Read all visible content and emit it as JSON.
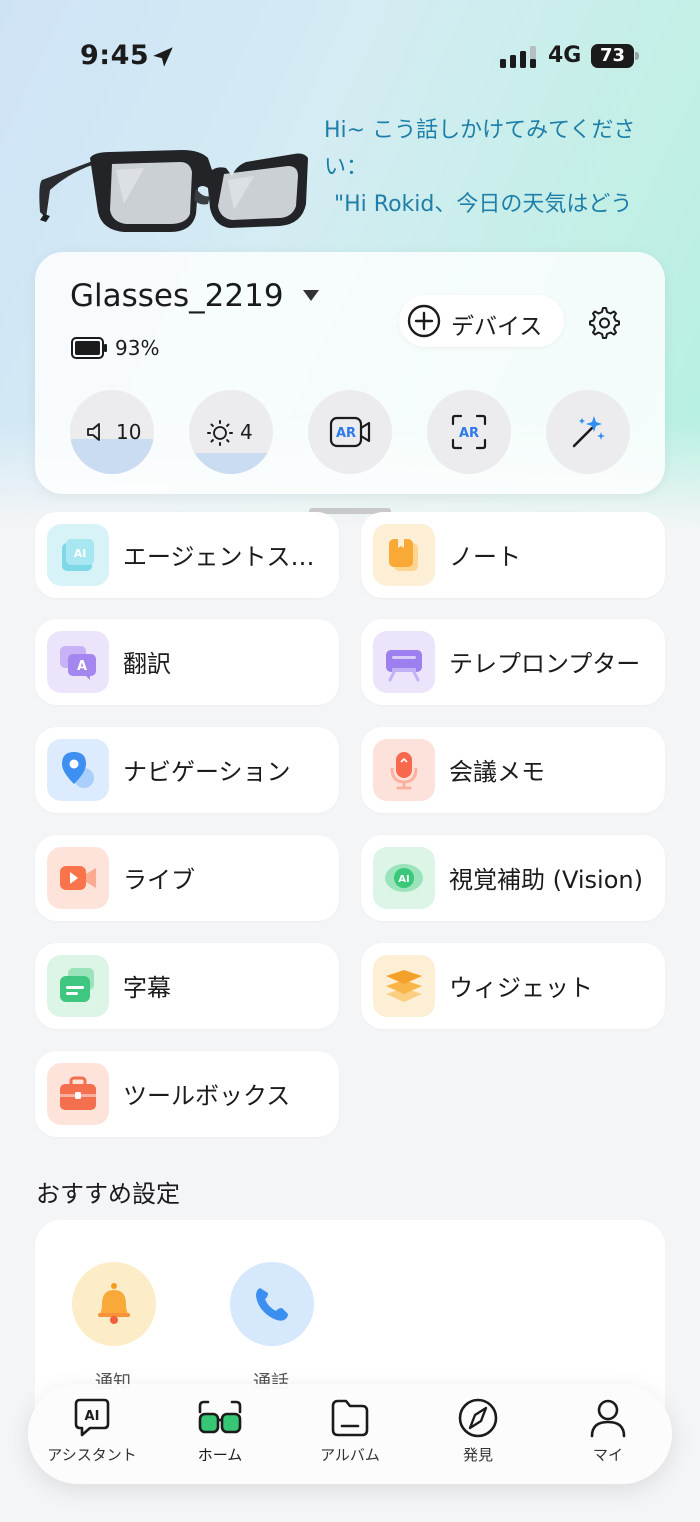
{
  "status_bar": {
    "time": "9:45",
    "network": "4G",
    "battery": "73"
  },
  "hero": {
    "prompt_lines": [
      "Hi~ こう話しかけてみてくださ",
      "い：",
      "\"Hi Rokid、今日の天気はどう"
    ]
  },
  "device": {
    "name": "Glasses_2219",
    "battery": "93%",
    "add_device_label": "デバイス",
    "controls": [
      {
        "name": "volume",
        "value": "10",
        "level": 0.42
      },
      {
        "name": "brightness",
        "value": "4",
        "level": 0.25
      },
      {
        "name": "ar-record"
      },
      {
        "name": "ar-scan"
      },
      {
        "name": "magic"
      }
    ]
  },
  "features": [
    {
      "label": "エージェントス…",
      "icon": "agent-store-icon",
      "color": "#d8f3f7"
    },
    {
      "label": "ノート",
      "icon": "note-icon",
      "color": "#fdefd6"
    },
    {
      "label": "翻訳",
      "icon": "translate-icon",
      "color": "#ece4fb"
    },
    {
      "label": "テレプロンプター",
      "icon": "teleprompter-icon",
      "color": "#ece4fb"
    },
    {
      "label": "ナビゲーション",
      "icon": "navigation-icon",
      "color": "#dcebfd"
    },
    {
      "label": "会議メモ",
      "icon": "meeting-memo-icon",
      "color": "#fde2dc"
    },
    {
      "label": "ライブ",
      "icon": "live-icon",
      "color": "#fde3da"
    },
    {
      "label": "視覚補助 (Vision)",
      "icon": "vision-icon",
      "color": "#dcf5e6"
    },
    {
      "label": "字幕",
      "icon": "subtitle-icon",
      "color": "#dcf5e6"
    },
    {
      "label": "ウィジェット",
      "icon": "widget-icon",
      "color": "#fdefd6"
    },
    {
      "label": "ツールボックス",
      "icon": "toolbox-icon",
      "color": "#fde3da"
    }
  ],
  "recommended": {
    "title": "おすすめ設定",
    "items": [
      {
        "label": "通知",
        "icon": "bell-icon",
        "color": "#fdecc8"
      },
      {
        "label": "通話",
        "icon": "phone-icon",
        "color": "#d6e8fb"
      }
    ]
  },
  "tabs": [
    {
      "label": "アシスタント",
      "icon": "assistant-icon"
    },
    {
      "label": "ホーム",
      "icon": "glasses-icon",
      "active": true
    },
    {
      "label": "アルバム",
      "icon": "album-icon"
    },
    {
      "label": "発見",
      "icon": "compass-icon"
    },
    {
      "label": "マイ",
      "icon": "profile-icon"
    }
  ],
  "colors": {
    "accent_text": "#1f7fa8",
    "brand_green": "#37c774"
  }
}
